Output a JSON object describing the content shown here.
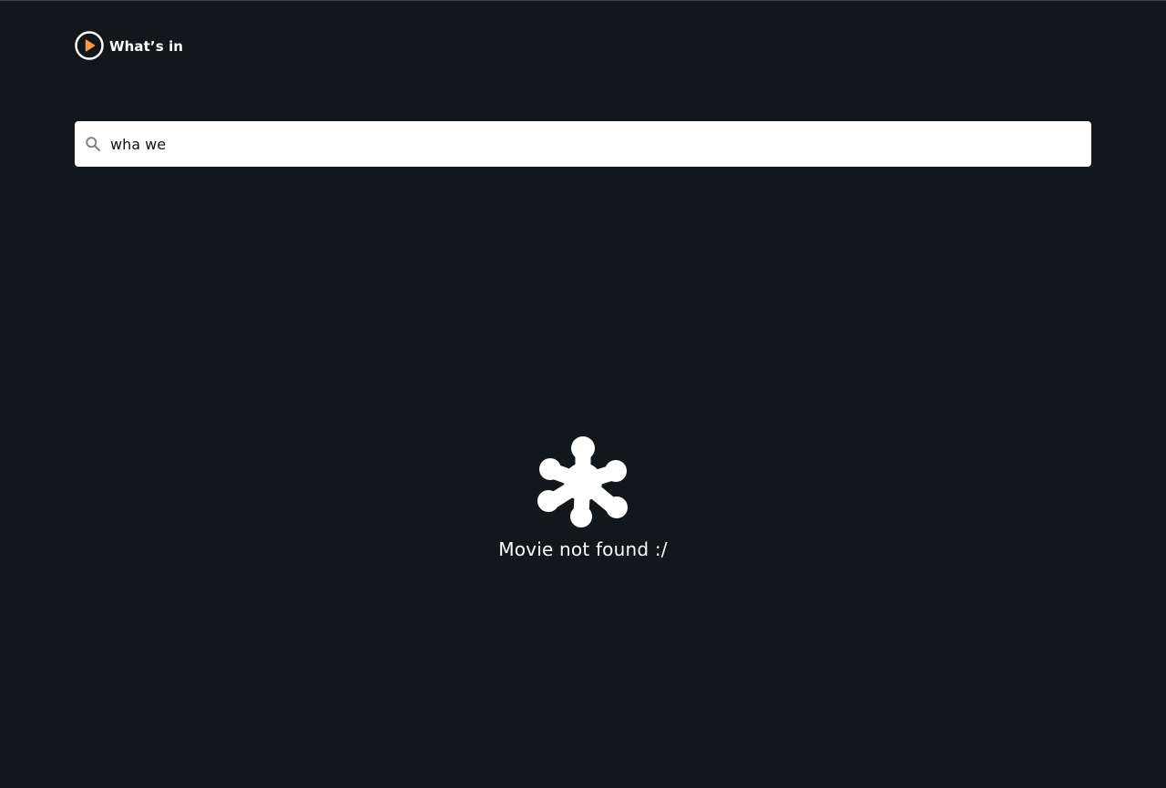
{
  "header": {
    "logo_text": "What’s in",
    "logo_icon": "play-circle-icon",
    "accent_color": "#f2994a"
  },
  "search": {
    "value": "wha we",
    "icon": "search-icon"
  },
  "empty_state": {
    "icon": "splat-icon",
    "message": "Movie not found :/"
  }
}
